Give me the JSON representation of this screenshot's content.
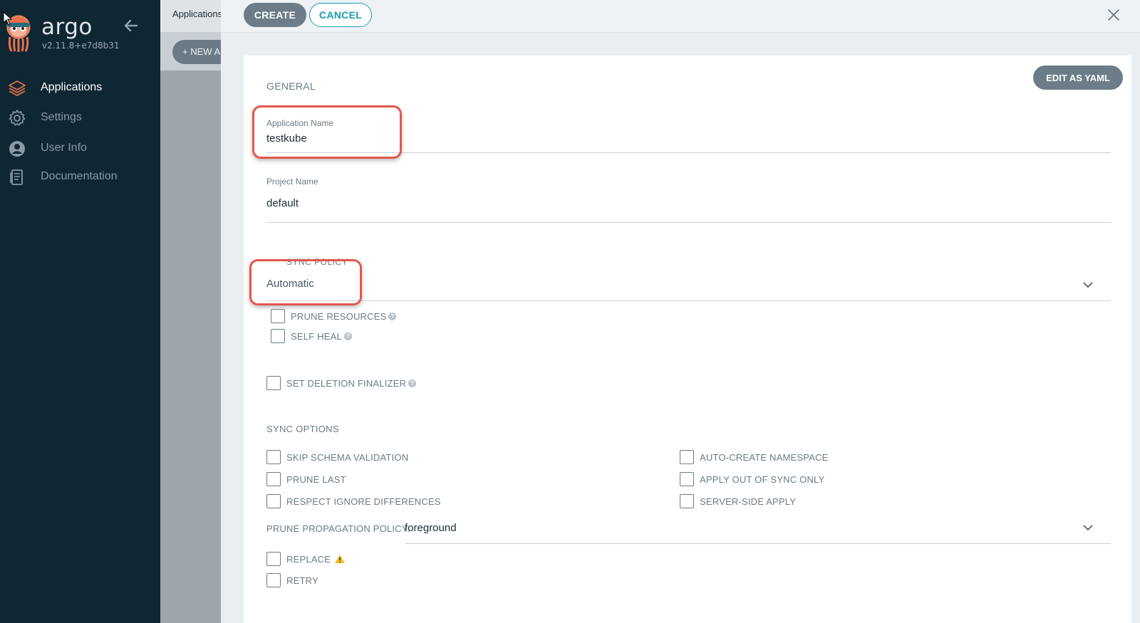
{
  "sidebar": {
    "brand": "argo",
    "version": "v2.11.8+e7d8b31",
    "items": [
      {
        "label": "Applications",
        "icon": "layers-icon",
        "active": true
      },
      {
        "label": "Settings",
        "icon": "gear-icon",
        "active": false
      },
      {
        "label": "User Info",
        "icon": "user-icon",
        "active": false
      },
      {
        "label": "Documentation",
        "icon": "document-icon",
        "active": false
      }
    ]
  },
  "underlay": {
    "breadcrumb": "Applications",
    "new_app_label": "NEW APP"
  },
  "panel": {
    "create_label": "CREATE",
    "cancel_label": "CANCEL",
    "edit_yaml_label": "EDIT AS YAML",
    "general_title": "GENERAL",
    "app_name": {
      "label": "Application Name",
      "value": "testkube"
    },
    "project_name": {
      "label": "Project Name",
      "value": "default"
    },
    "sync_policy": {
      "label": "SYNC POLICY",
      "value": "Automatic",
      "options": [
        {
          "label": "PRUNE RESOURCES",
          "help": true
        },
        {
          "label": "SELF HEAL",
          "help": true
        }
      ]
    },
    "deletion_finalizer": "SET DELETION FINALIZER",
    "sync_options_title": "SYNC OPTIONS",
    "sync_options_left": [
      "SKIP SCHEMA VALIDATION",
      "PRUNE LAST",
      "RESPECT IGNORE DIFFERENCES"
    ],
    "sync_options_right": [
      "AUTO-CREATE NAMESPACE",
      "APPLY OUT OF SYNC ONLY",
      "SERVER-SIDE APPLY"
    ],
    "prune_propagation": {
      "label": "PRUNE PROPAGATION POLICY:",
      "value": "foreground"
    },
    "replace_label": "REPLACE",
    "retry_label": "RETRY",
    "help_glyph": "?"
  },
  "colors": {
    "sidebar_bg": "#0f2733",
    "accent_teal": "#1a9cb0",
    "button_gray": "#6c7d89",
    "highlight_red": "#e2574c",
    "warning_yellow": "#f4c030"
  }
}
